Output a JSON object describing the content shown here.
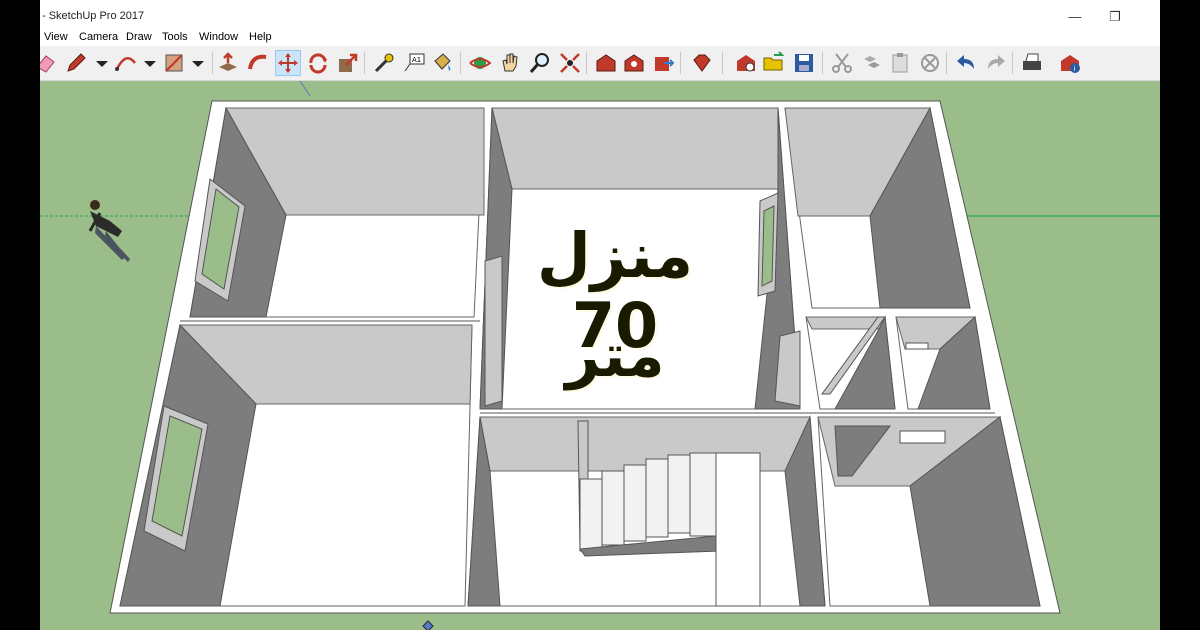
{
  "window": {
    "title": "- SketchUp Pro 2017",
    "minimize_icon": "minimize-icon",
    "restore_icon": "restore-icon"
  },
  "menu": {
    "items": [
      "View",
      "Camera",
      "Draw",
      "Tools",
      "Window",
      "Help"
    ]
  },
  "toolbar": {
    "tools": [
      "eraser-icon",
      "pencil-icon",
      "arc-icon",
      "rectangle-icon",
      "push-pull-icon",
      "follow-me-icon",
      "move-icon",
      "rotate-icon",
      "scale-icon",
      "tape-measure-icon",
      "text-icon",
      "paint-bucket-icon",
      "orbit-icon",
      "pan-icon",
      "zoom-icon",
      "zoom-extents-icon",
      "warehouse-icon",
      "share-model-icon",
      "extension-icon",
      "ruby-icon",
      "new-icon",
      "open-icon",
      "save-icon",
      "cut-icon",
      "copy-icon",
      "paste-icon",
      "delete-icon",
      "undo-icon",
      "redo-icon",
      "print-icon",
      "model-info-icon"
    ]
  },
  "overlay": {
    "line1": "منزل 70",
    "line2": "متر"
  },
  "colors": {
    "ground": "#9bbd8a",
    "wall_top": "#ffffff",
    "wall_shade": "#7a7a7a",
    "wall_light": "#c8c8c8",
    "floor": "#ffffff"
  }
}
